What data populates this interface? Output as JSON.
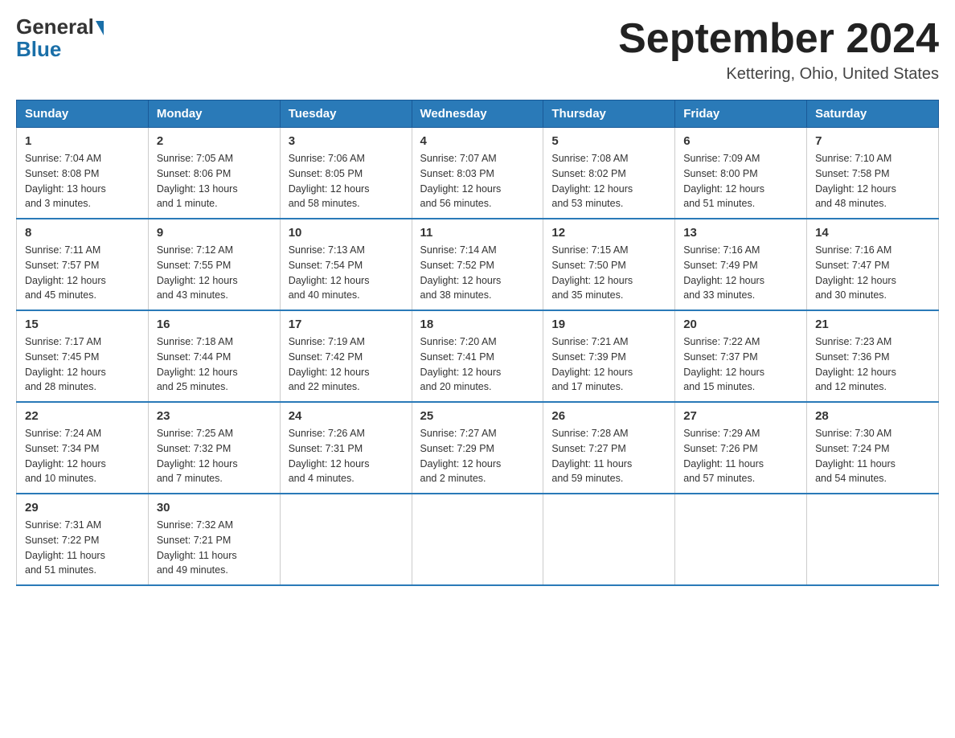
{
  "logo": {
    "general": "General",
    "blue": "Blue"
  },
  "title": "September 2024",
  "subtitle": "Kettering, Ohio, United States",
  "days_of_week": [
    "Sunday",
    "Monday",
    "Tuesday",
    "Wednesday",
    "Thursday",
    "Friday",
    "Saturday"
  ],
  "weeks": [
    [
      {
        "day": "1",
        "info": "Sunrise: 7:04 AM\nSunset: 8:08 PM\nDaylight: 13 hours\nand 3 minutes."
      },
      {
        "day": "2",
        "info": "Sunrise: 7:05 AM\nSunset: 8:06 PM\nDaylight: 13 hours\nand 1 minute."
      },
      {
        "day": "3",
        "info": "Sunrise: 7:06 AM\nSunset: 8:05 PM\nDaylight: 12 hours\nand 58 minutes."
      },
      {
        "day": "4",
        "info": "Sunrise: 7:07 AM\nSunset: 8:03 PM\nDaylight: 12 hours\nand 56 minutes."
      },
      {
        "day": "5",
        "info": "Sunrise: 7:08 AM\nSunset: 8:02 PM\nDaylight: 12 hours\nand 53 minutes."
      },
      {
        "day": "6",
        "info": "Sunrise: 7:09 AM\nSunset: 8:00 PM\nDaylight: 12 hours\nand 51 minutes."
      },
      {
        "day": "7",
        "info": "Sunrise: 7:10 AM\nSunset: 7:58 PM\nDaylight: 12 hours\nand 48 minutes."
      }
    ],
    [
      {
        "day": "8",
        "info": "Sunrise: 7:11 AM\nSunset: 7:57 PM\nDaylight: 12 hours\nand 45 minutes."
      },
      {
        "day": "9",
        "info": "Sunrise: 7:12 AM\nSunset: 7:55 PM\nDaylight: 12 hours\nand 43 minutes."
      },
      {
        "day": "10",
        "info": "Sunrise: 7:13 AM\nSunset: 7:54 PM\nDaylight: 12 hours\nand 40 minutes."
      },
      {
        "day": "11",
        "info": "Sunrise: 7:14 AM\nSunset: 7:52 PM\nDaylight: 12 hours\nand 38 minutes."
      },
      {
        "day": "12",
        "info": "Sunrise: 7:15 AM\nSunset: 7:50 PM\nDaylight: 12 hours\nand 35 minutes."
      },
      {
        "day": "13",
        "info": "Sunrise: 7:16 AM\nSunset: 7:49 PM\nDaylight: 12 hours\nand 33 minutes."
      },
      {
        "day": "14",
        "info": "Sunrise: 7:16 AM\nSunset: 7:47 PM\nDaylight: 12 hours\nand 30 minutes."
      }
    ],
    [
      {
        "day": "15",
        "info": "Sunrise: 7:17 AM\nSunset: 7:45 PM\nDaylight: 12 hours\nand 28 minutes."
      },
      {
        "day": "16",
        "info": "Sunrise: 7:18 AM\nSunset: 7:44 PM\nDaylight: 12 hours\nand 25 minutes."
      },
      {
        "day": "17",
        "info": "Sunrise: 7:19 AM\nSunset: 7:42 PM\nDaylight: 12 hours\nand 22 minutes."
      },
      {
        "day": "18",
        "info": "Sunrise: 7:20 AM\nSunset: 7:41 PM\nDaylight: 12 hours\nand 20 minutes."
      },
      {
        "day": "19",
        "info": "Sunrise: 7:21 AM\nSunset: 7:39 PM\nDaylight: 12 hours\nand 17 minutes."
      },
      {
        "day": "20",
        "info": "Sunrise: 7:22 AM\nSunset: 7:37 PM\nDaylight: 12 hours\nand 15 minutes."
      },
      {
        "day": "21",
        "info": "Sunrise: 7:23 AM\nSunset: 7:36 PM\nDaylight: 12 hours\nand 12 minutes."
      }
    ],
    [
      {
        "day": "22",
        "info": "Sunrise: 7:24 AM\nSunset: 7:34 PM\nDaylight: 12 hours\nand 10 minutes."
      },
      {
        "day": "23",
        "info": "Sunrise: 7:25 AM\nSunset: 7:32 PM\nDaylight: 12 hours\nand 7 minutes."
      },
      {
        "day": "24",
        "info": "Sunrise: 7:26 AM\nSunset: 7:31 PM\nDaylight: 12 hours\nand 4 minutes."
      },
      {
        "day": "25",
        "info": "Sunrise: 7:27 AM\nSunset: 7:29 PM\nDaylight: 12 hours\nand 2 minutes."
      },
      {
        "day": "26",
        "info": "Sunrise: 7:28 AM\nSunset: 7:27 PM\nDaylight: 11 hours\nand 59 minutes."
      },
      {
        "day": "27",
        "info": "Sunrise: 7:29 AM\nSunset: 7:26 PM\nDaylight: 11 hours\nand 57 minutes."
      },
      {
        "day": "28",
        "info": "Sunrise: 7:30 AM\nSunset: 7:24 PM\nDaylight: 11 hours\nand 54 minutes."
      }
    ],
    [
      {
        "day": "29",
        "info": "Sunrise: 7:31 AM\nSunset: 7:22 PM\nDaylight: 11 hours\nand 51 minutes."
      },
      {
        "day": "30",
        "info": "Sunrise: 7:32 AM\nSunset: 7:21 PM\nDaylight: 11 hours\nand 49 minutes."
      },
      {
        "day": "",
        "info": ""
      },
      {
        "day": "",
        "info": ""
      },
      {
        "day": "",
        "info": ""
      },
      {
        "day": "",
        "info": ""
      },
      {
        "day": "",
        "info": ""
      }
    ]
  ]
}
